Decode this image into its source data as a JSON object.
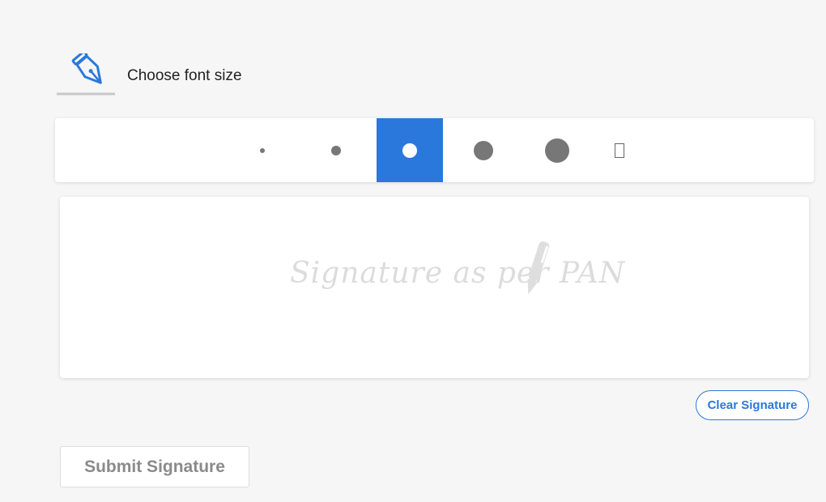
{
  "header": {
    "title": "Choose font size",
    "icon": "pen-nib-icon",
    "accent": "#2b78dc"
  },
  "font_sizes": {
    "options": [
      "size-1",
      "size-2",
      "size-3",
      "size-4",
      "size-5",
      "size-6"
    ],
    "selected_index": 2,
    "selected_color": "#2b78dc"
  },
  "signature_pad": {
    "placeholder": "Signature as per PAN",
    "icon": "pen-icon"
  },
  "actions": {
    "clear_label": "Clear Signature",
    "submit_label": "Submit Signature"
  }
}
